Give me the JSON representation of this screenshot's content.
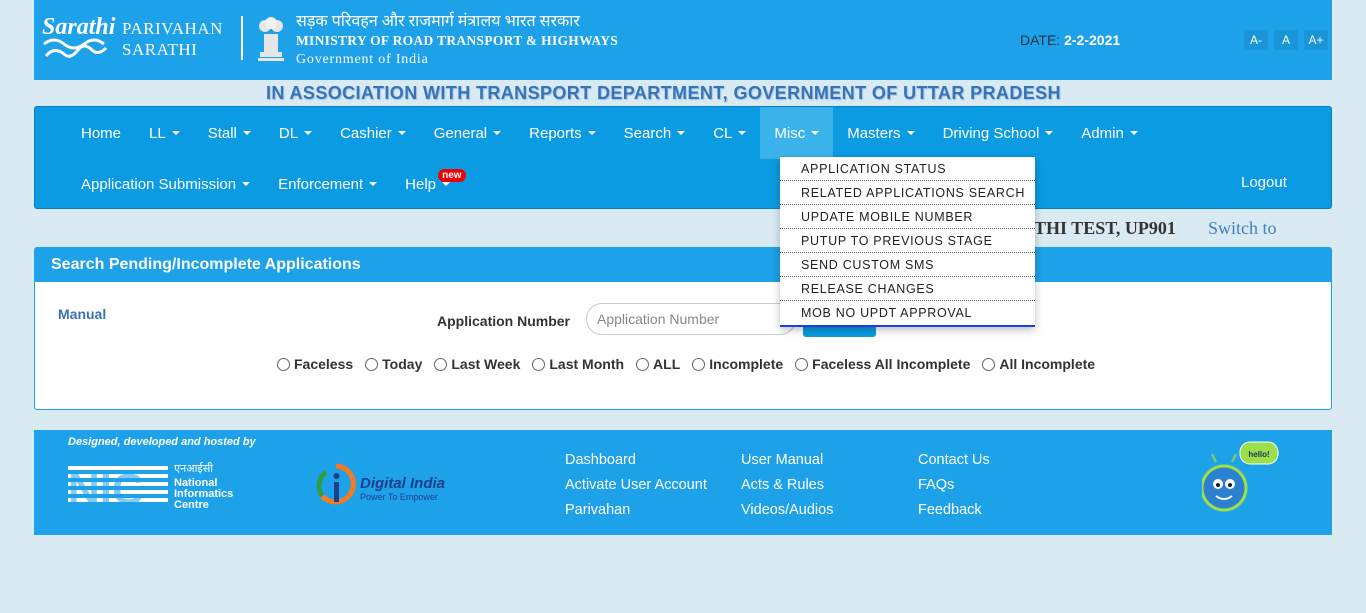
{
  "header": {
    "brand_line1": "PARIVAHAN",
    "brand_line2": "SARATHI",
    "logo_text": "Sarathi",
    "ministry_hindi": "सड़क परिवहन और राजमार्ग मंत्रालय भारत सरकार",
    "ministry_english": "MINISTRY OF ROAD TRANSPORT & HIGHWAYS",
    "government": "Government of India",
    "date_label": "DATE:",
    "date_value": "2-2-2021",
    "font_buttons": [
      "A-",
      "A",
      "A+"
    ]
  },
  "association": "IN ASSOCIATION WITH TRANSPORT DEPARTMENT, GOVERNMENT OF UTTAR PRADESH",
  "nav": {
    "row1": [
      {
        "label": "Home",
        "caret": false
      },
      {
        "label": "LL",
        "caret": true
      },
      {
        "label": "Stall",
        "caret": true
      },
      {
        "label": "DL",
        "caret": true
      },
      {
        "label": "Cashier",
        "caret": true
      },
      {
        "label": "General",
        "caret": true
      },
      {
        "label": "Reports",
        "caret": true
      },
      {
        "label": "Search",
        "caret": true
      },
      {
        "label": "CL",
        "caret": true
      },
      {
        "label": "Misc",
        "caret": true,
        "active": true
      },
      {
        "label": "Masters",
        "caret": true
      },
      {
        "label": "Driving School",
        "caret": true
      },
      {
        "label": "Admin",
        "caret": true
      }
    ],
    "row2": [
      {
        "label": "Application Submission",
        "caret": true
      },
      {
        "label": "Enforcement",
        "caret": true
      },
      {
        "label": "Help",
        "caret": true,
        "badge": "new"
      }
    ],
    "logout": "Logout"
  },
  "misc_dropdown": [
    "APPLICATION STATUS",
    "RELATED APPLICATIONS SEARCH",
    "UPDATE MOBILE NUMBER",
    "PUTUP TO PREVIOUS STAGE",
    "SEND CUSTOM SMS",
    "RELEASE CHANGES",
    "MOB NO UPDT APPROVAL"
  ],
  "user": {
    "name_partial": "THI TEST, UP901",
    "switch_label": "Switch to"
  },
  "panel": {
    "title": "Search Pending/Incomplete Applications",
    "manual": "Manual",
    "app_number_label": "Application Number",
    "app_number_placeholder": "Application Number",
    "filters": [
      "Faceless",
      "Today",
      "Last Week",
      "Last Month",
      "ALL",
      "Incomplete",
      "Faceless All Incomplete",
      "All Incomplete"
    ]
  },
  "footer": {
    "designed_by": "Designed, developed and hosted by",
    "nic_hindi": "एनआईसी",
    "nic_lines": [
      "National",
      "Informatics",
      "Centre"
    ],
    "nic_abbr": "NIC",
    "digital_india": "Digital India",
    "digital_tagline": "Power To Empower",
    "col1": [
      "Dashboard",
      "Activate User Account",
      "Parivahan"
    ],
    "col2": [
      "User Manual",
      "Acts & Rules",
      "Videos/Audios"
    ],
    "col3": [
      "Contact Us",
      "FAQs",
      "Feedback"
    ],
    "mascot_bubble": "hello!"
  },
  "colors": {
    "header_blue": "#1da1e8",
    "nav_blue": "#0b9be2",
    "page_bg": "#daeaf3"
  }
}
